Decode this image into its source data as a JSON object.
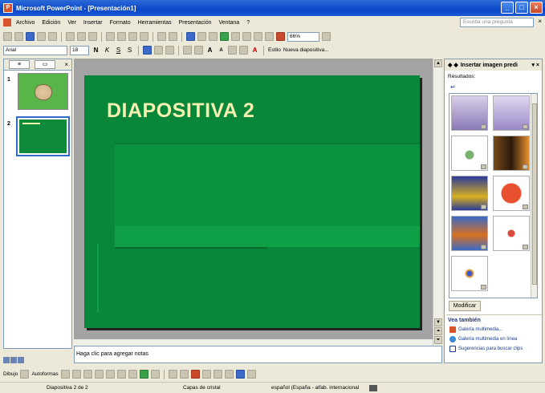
{
  "window": {
    "title": "Microsoft PowerPoint - [Presentación1]"
  },
  "menu": [
    "Archivo",
    "Edición",
    "Ver",
    "Insertar",
    "Formato",
    "Herramientas",
    "Presentación",
    "Ventana",
    "?"
  ],
  "help_placeholder": "Escriba una pregunta",
  "toolbar": {
    "zoom": "66%",
    "font": "Arial",
    "font_size": "18",
    "design_label": "Estilo",
    "new_slide_label": "Nueva diapositiva..."
  },
  "outline": {
    "slides": [
      {
        "number": "1"
      },
      {
        "number": "2"
      }
    ]
  },
  "slide": {
    "title": "DIAPOSITIVA 2"
  },
  "notes": {
    "placeholder": "Haga clic para agregar notas"
  },
  "taskpane": {
    "title": "Insertar imagen predi",
    "results_label": "Resultados:",
    "modify_label": "Modificar",
    "see_also_title": "Vea también",
    "links": [
      "Galería multimedia...",
      "Galería multimedia en línea",
      "Sugerencias para buscar clips"
    ]
  },
  "drawing": {
    "draw_label": "Dibujo",
    "autoshapes_label": "Autoformas"
  },
  "status": {
    "slide_pos": "Diapositiva 2 de 2",
    "design": "Capas de cristal",
    "language": "español (España - alfab. internacional"
  },
  "colors": {
    "slide_bg": "#08873a",
    "title_color": "#f4f0b0",
    "titlebar": "#0a46c8"
  }
}
